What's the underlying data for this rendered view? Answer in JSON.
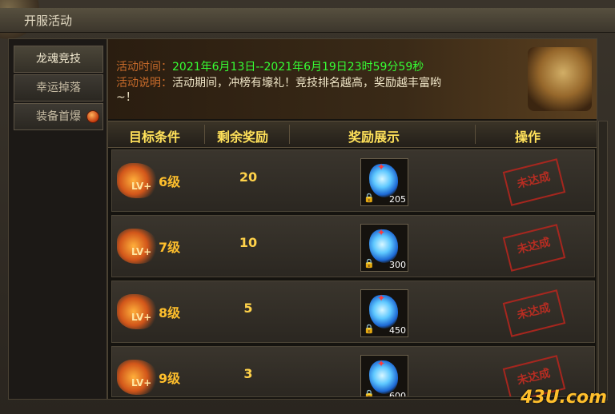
{
  "window": {
    "title": "开服活动"
  },
  "nav": {
    "items": [
      {
        "label": "龙魂竞技",
        "active": true,
        "badge": false
      },
      {
        "label": "幸运掉落",
        "active": false,
        "badge": false
      },
      {
        "label": "装备首爆",
        "active": false,
        "badge": true
      }
    ]
  },
  "banner": {
    "time_label": "活动时间：",
    "time_value": "2021年6月13日--2021年6月19日23时59分59秒",
    "desc_label": "活动说明：",
    "desc_value": "活动期间，冲榜有壕礼！竞技排名越高，奖励越丰富哟",
    "desc_tail": "~！"
  },
  "table": {
    "headers": [
      "目标条件",
      "剩余奖励",
      "奖励展示",
      "操作"
    ],
    "rows": [
      {
        "lv_plus": "LV+",
        "level": "6级",
        "remaining": "20",
        "reward_qty": "205",
        "status": "未达成"
      },
      {
        "lv_plus": "LV+",
        "level": "7级",
        "remaining": "10",
        "reward_qty": "300",
        "status": "未达成"
      },
      {
        "lv_plus": "LV+",
        "level": "8级",
        "remaining": "5",
        "reward_qty": "450",
        "status": "未达成"
      },
      {
        "lv_plus": "LV+",
        "level": "9级",
        "remaining": "3",
        "reward_qty": "600",
        "status": "未达成"
      }
    ]
  },
  "watermark": "43U.com",
  "colors": {
    "accent_gold": "#ffbf2c",
    "time_green": "#36ff34",
    "label_orange": "#c66a2a",
    "stamp_red": "#c52d22"
  }
}
